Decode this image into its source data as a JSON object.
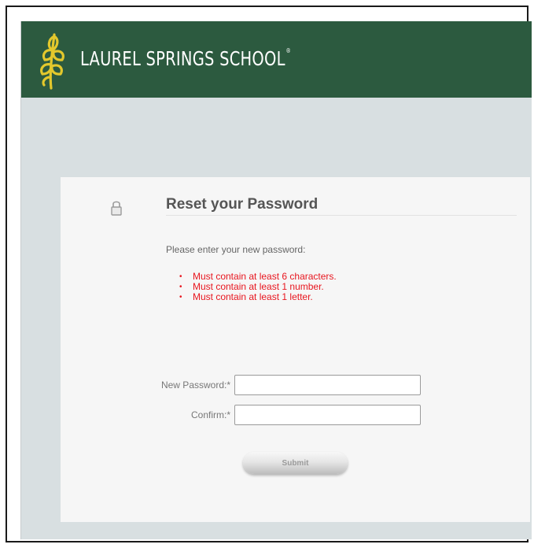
{
  "header": {
    "school_name": "LAUREL SPRINGS SCHOOL",
    "trademark": "®",
    "logo_icon": "wheat-leaf-icon",
    "bg_color": "#2c5a3f"
  },
  "reset_form": {
    "title": "Reset your Password",
    "icon": "lock-icon",
    "instructions": "Please enter your new password:",
    "rules": [
      "Must contain at least 6 characters.",
      "Must contain at least 1 number.",
      "Must contain at least 1 letter."
    ],
    "rules_color": "#e8161f",
    "new_password_label": "New Password:*",
    "new_password_value": "",
    "confirm_label": "Confirm:*",
    "confirm_value": "",
    "submit_label": "Submit"
  }
}
